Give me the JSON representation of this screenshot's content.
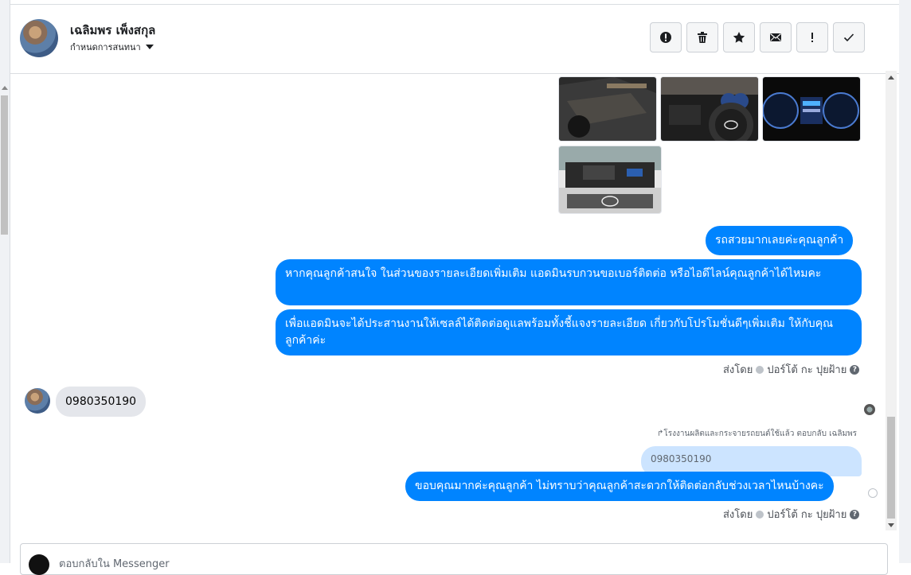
{
  "header": {
    "contact_name": "เฉลิมพร เพ็งสกุล",
    "conversation_menu_label": "กำหนดการสนทนา",
    "actions": [
      {
        "name": "report-button",
        "icon": "alert-circle-icon"
      },
      {
        "name": "delete-button",
        "icon": "trash-icon"
      },
      {
        "name": "star-button",
        "icon": "star-icon"
      },
      {
        "name": "mark-unread-button",
        "icon": "envelope-icon"
      },
      {
        "name": "important-button",
        "icon": "exclamation-icon"
      },
      {
        "name": "mark-done-button",
        "icon": "check-icon"
      }
    ]
  },
  "messages": {
    "out1": "รถสวยมากเลยค่ะคุณลูกค้า",
    "out2": "หากคุณลูกค้าสนใจ ในส่วนของรายละเอียดเพิ่มเติม แอดมินรบกวนขอเบอร์ติดต่อ หรือไอดีไลน์คุณลูกค้าได้ไหมคะ",
    "out3": "เพื่อแอดมินจะได้ประสานงานให้เซลล์ได้ติดต่อดูแลพร้อมทั้งชี้แจงรายละเอียด เกี่ยวกับโปรโมชั่นดีๆเพิ่มเติม ให้กับคุณลูกค้าค่ะ",
    "sent_by_1": "ส่งโดย",
    "sender_name_1": "ปอร์โต้ กะ ปุยฝ้าย",
    "incoming_phone": "0980350190",
    "reply_note": "↱โรงงานผลิตและกระจายรถยนต์ใช้แล้ว ตอบกลับ เฉลิมพร",
    "quoted_text": "0980350190",
    "out4": "ขอบคุณมากค่ะคุณลูกค้า ไม่ทราบว่าคุณลูกค้าสะดวกให้ติดต่อกลับช่วงเวลาไหนบ้างคะ",
    "sent_by_2": "ส่งโดย",
    "sender_name_2": "ปอร์โต้ กะ ปุยฝ้าย"
  },
  "composer": {
    "placeholder": "ตอบกลับใน Messenger"
  }
}
